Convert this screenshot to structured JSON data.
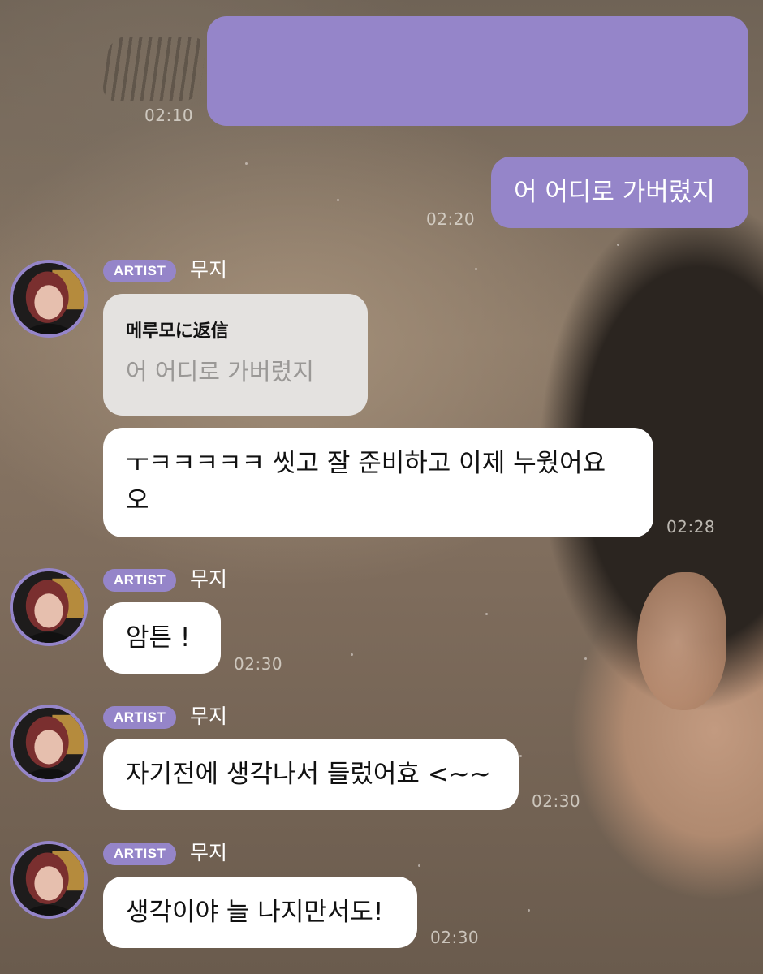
{
  "colors": {
    "accent": "#9585c9",
    "incoming_bubble": "#ffffff",
    "reply_quote_bg": "#e4e2e0"
  },
  "messages": {
    "m1": {
      "text": "",
      "time": "02:10"
    },
    "m2": {
      "text": "어 어디로 가버렸지",
      "time": "02:20"
    },
    "m3": {
      "badge": "ARTIST",
      "name": "무지",
      "reply_title": "메루모に返信",
      "reply_text": "어 어디로 가버렸지",
      "line1": "ㅜㅋㅋㅋㅋㅋ 씻고 잘 준비하고 이제 누웠어요",
      "line2": "오",
      "time": "02:28"
    },
    "m4": {
      "badge": "ARTIST",
      "name": "무지",
      "text": "암튼 !",
      "time": "02:30"
    },
    "m5": {
      "badge": "ARTIST",
      "name": "무지",
      "text": "자기전에 생각나서 들렀어효 <~~",
      "time": "02:30"
    },
    "m6": {
      "badge": "ARTIST",
      "name": "무지",
      "text": "생각이야 늘 나지만서도!",
      "time": "02:30"
    }
  }
}
